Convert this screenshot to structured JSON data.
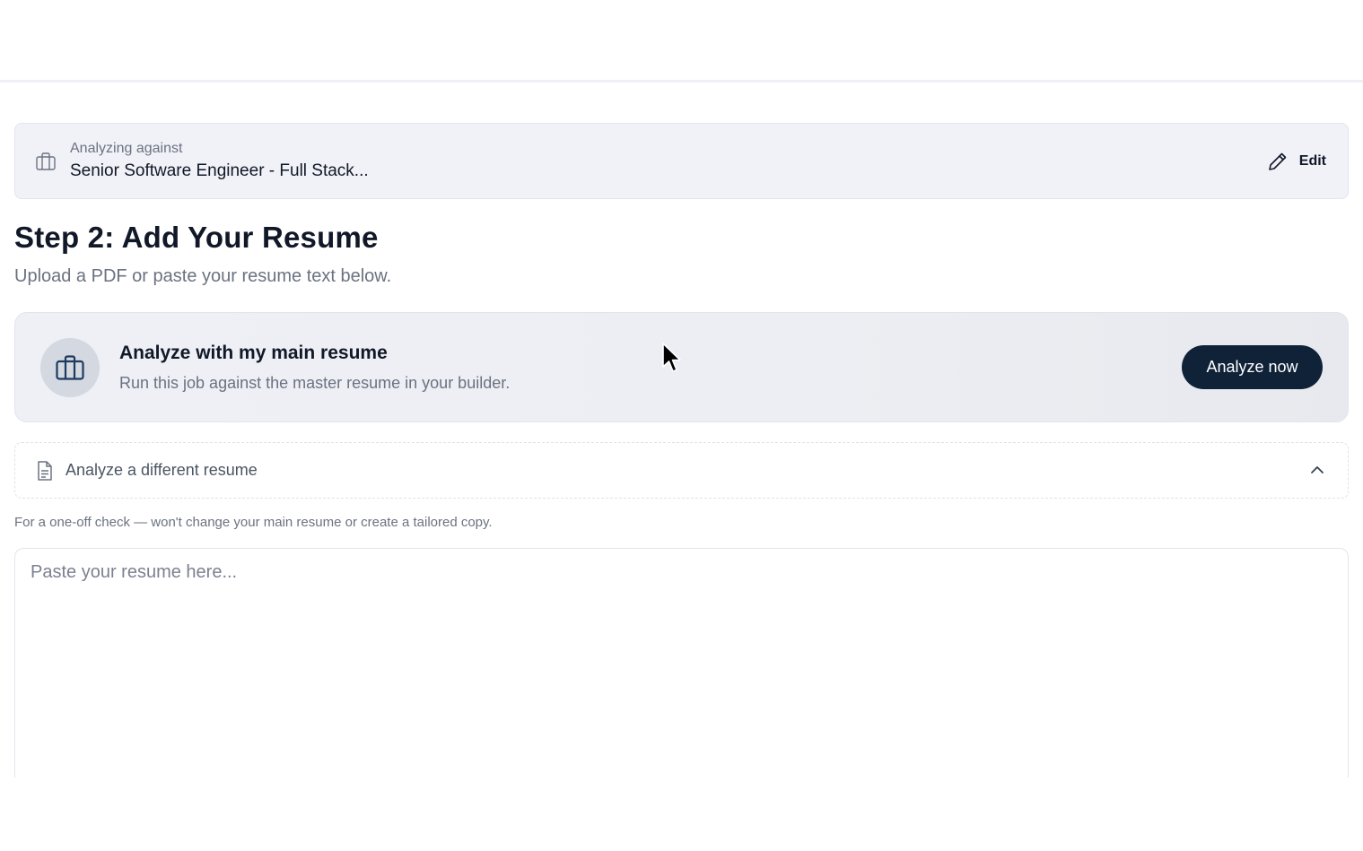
{
  "job": {
    "label": "Analyzing against",
    "title": "Senior Software Engineer - Full Stack...",
    "edit_label": "Edit"
  },
  "step": {
    "title": "Step 2: Add Your Resume",
    "subtitle": "Upload a PDF or paste your resume text below."
  },
  "main_resume": {
    "title": "Analyze with my main resume",
    "description": "Run this job against the master resume in your builder.",
    "button_label": "Analyze now"
  },
  "alternate": {
    "label": "Analyze a different resume",
    "hint": "For a one-off check — won't change your main resume or create a tailored copy."
  },
  "paste": {
    "placeholder": "Paste your resume here...",
    "value": ""
  },
  "icons": {
    "job": "briefcase-icon",
    "edit": "pencil-icon",
    "main_resume": "briefcase-icon",
    "alternate": "document-icon",
    "toggle": "chevron-up-icon",
    "cursor": "mouse-pointer-icon"
  },
  "colors": {
    "primary_button": "#0f2238",
    "job_bar_bg": "#f1f2f8",
    "card_bg": "#eceef3",
    "muted_text": "#6b7280"
  }
}
